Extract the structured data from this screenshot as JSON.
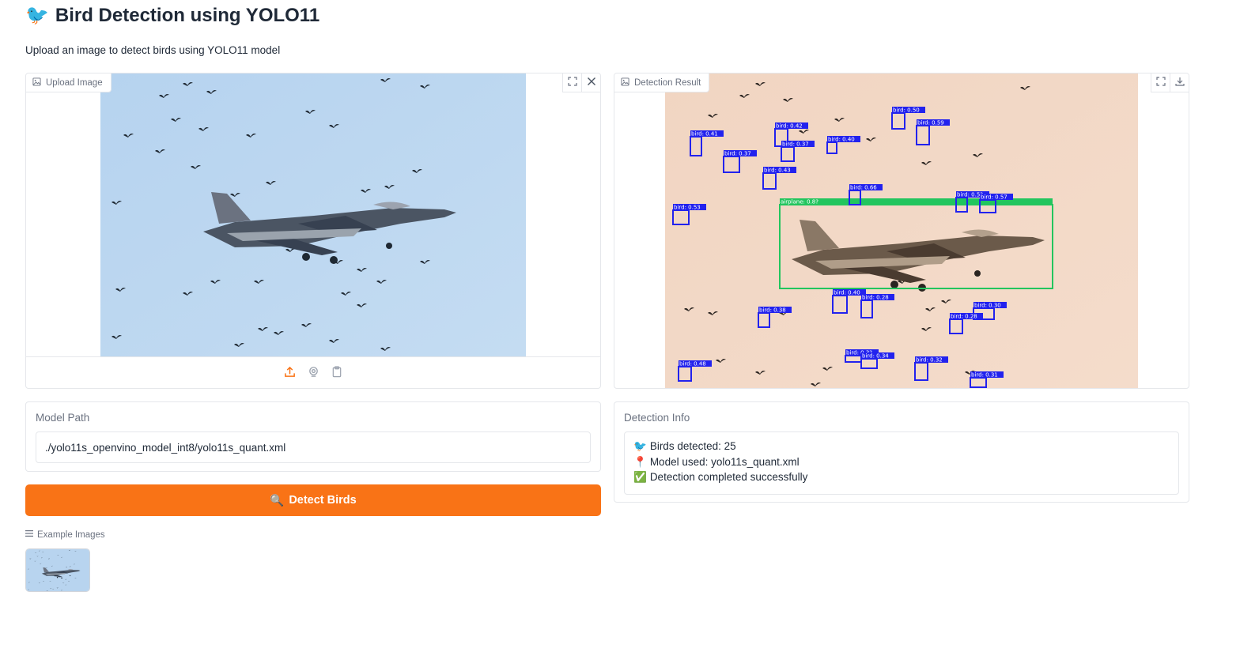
{
  "app": {
    "title_emoji": "🐦",
    "title": "Bird Detection using YOLO11",
    "subtitle": "Upload an image to detect birds using YOLO11 model"
  },
  "upload": {
    "label": "Upload Image",
    "fullscreen_icon": "fullscreen-icon",
    "clear_icon": "close-icon",
    "footer_icons": [
      "upload-icon",
      "webcam-icon",
      "clipboard-icon"
    ],
    "accent_color": "#f97316"
  },
  "result": {
    "label": "Detection Result",
    "fullscreen_icon": "fullscreen-icon",
    "download_icon": "download-icon",
    "detections": [
      {
        "label": "airplane: 0.8?",
        "color": "#22c55e"
      },
      {
        "label": "bird: 0.50",
        "color": "#2222ee"
      },
      {
        "label": "bird: 0.59",
        "color": "#2222ee"
      },
      {
        "label": "bird: 0.41",
        "color": "#2222ee"
      },
      {
        "label": "bird: 0.42",
        "color": "#2222ee"
      },
      {
        "label": "bird: 0.37",
        "color": "#2222ee"
      },
      {
        "label": "bird: 0.37",
        "color": "#2222ee"
      },
      {
        "label": "bird: 0.40",
        "color": "#2222ee"
      },
      {
        "label": "bird: 0.43",
        "color": "#2222ee"
      },
      {
        "label": "bird: 0.66",
        "color": "#2222ee"
      },
      {
        "label": "bird: 0.5?",
        "color": "#2222ee"
      },
      {
        "label": "bird: 0.57",
        "color": "#2222ee"
      },
      {
        "label": "bird: 0.53",
        "color": "#2222ee"
      },
      {
        "label": "bird: 0.40",
        "color": "#2222ee"
      },
      {
        "label": "bird: 0.28",
        "color": "#2222ee"
      },
      {
        "label": "bird: 0.38",
        "color": "#2222ee"
      },
      {
        "label": "bird: 0.30",
        "color": "#2222ee"
      },
      {
        "label": "bird: 0.28",
        "color": "#2222ee"
      },
      {
        "label": "bird: 0.48",
        "color": "#2222ee"
      },
      {
        "label": "bird: 0.3?",
        "color": "#2222ee"
      },
      {
        "label": "bird: 0.34",
        "color": "#2222ee"
      },
      {
        "label": "bird: 0.32",
        "color": "#2222ee"
      },
      {
        "label": "bird: 0.31",
        "color": "#2222ee"
      }
    ]
  },
  "model": {
    "label": "Model Path",
    "value": "./yolo11s_openvino_model_int8/yolo11s_quant.xml"
  },
  "detect_button": {
    "emoji": "🔍",
    "label": "Detect Birds",
    "color": "#f97316"
  },
  "info": {
    "label": "Detection Info",
    "lines": [
      {
        "emoji": "🐦",
        "text": "Birds detected: 25"
      },
      {
        "emoji": "📍",
        "text": "Model used: yolo11s_quant.xml"
      },
      {
        "emoji": "✅",
        "text": "Detection completed successfully"
      }
    ]
  },
  "examples": {
    "label": "Example Images",
    "list_icon": "list-icon"
  }
}
